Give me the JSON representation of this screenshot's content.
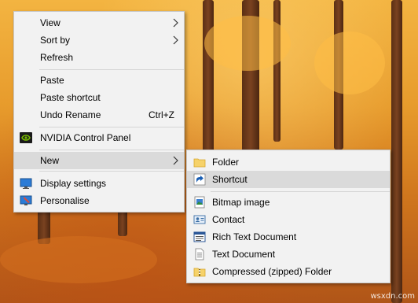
{
  "context_menu": {
    "items": [
      {
        "label": "View",
        "has_submenu": true
      },
      {
        "label": "Sort by",
        "has_submenu": true
      },
      {
        "label": "Refresh"
      },
      {
        "label": "Paste"
      },
      {
        "label": "Paste shortcut"
      },
      {
        "label": "Undo Rename",
        "shortcut": "Ctrl+Z"
      },
      {
        "label": "NVIDIA Control Panel",
        "icon": "nvidia-icon"
      },
      {
        "label": "New",
        "has_submenu": true,
        "highlighted": true
      },
      {
        "label": "Display settings",
        "icon": "display-settings-icon"
      },
      {
        "label": "Personalise",
        "icon": "personalise-icon"
      }
    ]
  },
  "new_submenu": {
    "items": [
      {
        "label": "Folder",
        "icon": "folder-icon"
      },
      {
        "label": "Shortcut",
        "icon": "shortcut-icon",
        "highlighted": true
      },
      {
        "label": "Bitmap image",
        "icon": "bitmap-image-icon"
      },
      {
        "label": "Contact",
        "icon": "contact-icon"
      },
      {
        "label": "Rich Text Document",
        "icon": "rich-text-document-icon"
      },
      {
        "label": "Text Document",
        "icon": "text-document-icon"
      },
      {
        "label": "Compressed (zipped) Folder",
        "icon": "zip-folder-icon"
      }
    ]
  },
  "watermark": "wsxdn.com",
  "colors": {
    "menu_background": "#f2f2f2",
    "menu_highlight": "#dadada",
    "menu_border": "#c6c6c6",
    "wallpaper_primary": "#e79b2c"
  }
}
